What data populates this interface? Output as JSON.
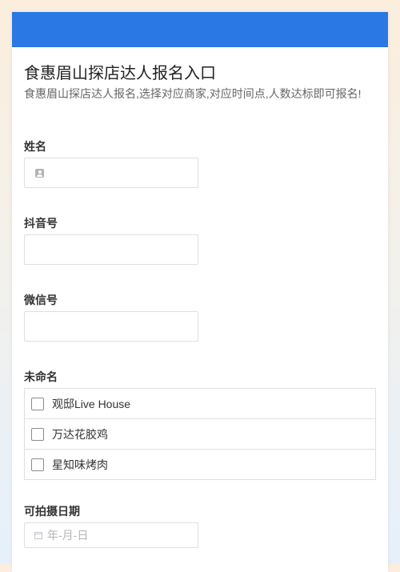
{
  "form": {
    "title": "食惠眉山探店达人报名入口",
    "description": "食惠眉山探店达人报名,选择对应商家,对应时间点,人数达标即可报名!"
  },
  "fields": {
    "name": {
      "label": "姓名",
      "value": ""
    },
    "douyin": {
      "label": "抖音号",
      "value": ""
    },
    "wechat": {
      "label": "微信号",
      "value": ""
    },
    "unnamed": {
      "label": "未命名",
      "options": [
        {
          "label": "观邸Live House",
          "checked": false
        },
        {
          "label": "万达花胶鸡",
          "checked": false
        },
        {
          "label": "星知味烤肉",
          "checked": false
        }
      ]
    },
    "shoot_date": {
      "label": "可拍摄日期",
      "placeholder": "年-月-日"
    }
  },
  "colors": {
    "header_bar": "#2a78e4",
    "page_bg_top": "#fbeedd",
    "page_bg_bottom": "#e6f0fb"
  },
  "icons": {
    "name_field": "person-icon",
    "date_field": "calendar-icon"
  }
}
